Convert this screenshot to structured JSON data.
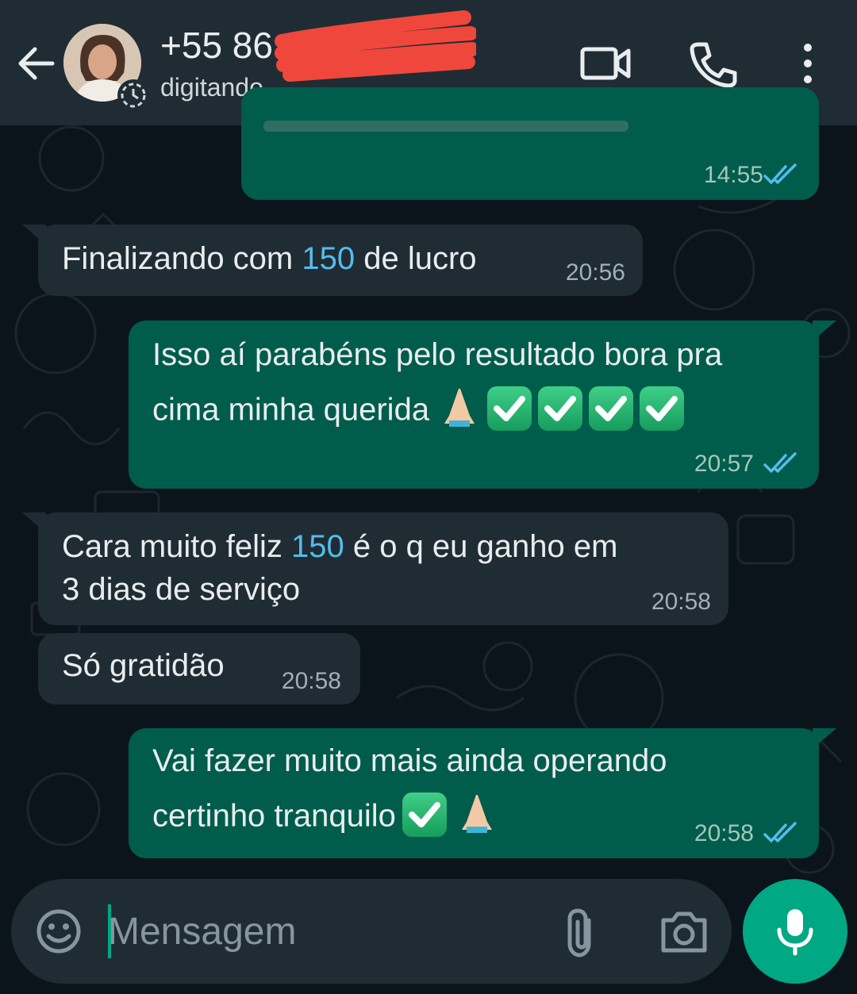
{
  "header": {
    "contact_name": "+55 86",
    "status": "digitando..."
  },
  "messages": [
    {
      "dir": "out",
      "text": "",
      "time": "14:55",
      "note": "partially hidden message"
    },
    {
      "dir": "in",
      "text_before": "Finalizando com ",
      "number": "150",
      "text_after": " de lucro",
      "time": "20:56"
    },
    {
      "dir": "out",
      "line1": "Isso aí parabéns pelo resultado bora pra",
      "line2": "cima minha querida",
      "time": "20:57"
    },
    {
      "dir": "in",
      "text_before": "Cara muito feliz ",
      "number": "150",
      "text_after": " é o q eu ganho em",
      "line2": "3 dias de serviço",
      "time": "20:58"
    },
    {
      "dir": "in",
      "text": "Só gratidão",
      "time": "20:58"
    },
    {
      "dir": "out",
      "line1": "Vai fazer muito mais ainda operando",
      "line2": "certinho tranquilo",
      "time": "20:58"
    }
  ],
  "composer": {
    "placeholder": "Mensagem"
  },
  "colors": {
    "header_bg": "#202c33",
    "chat_bg": "#0b141a",
    "incoming_bubble": "#202c33",
    "outgoing_bubble": "#005c4b",
    "accent": "#00a884",
    "read_ticks": "#53bdeb"
  },
  "icons": [
    "back-arrow-icon",
    "video-call-icon",
    "phone-icon",
    "more-vert-icon",
    "emoji-icon",
    "attach-icon",
    "camera-icon",
    "mic-icon",
    "double-check-icon",
    "folded-hands-emoji",
    "check-mark-emoji"
  ]
}
